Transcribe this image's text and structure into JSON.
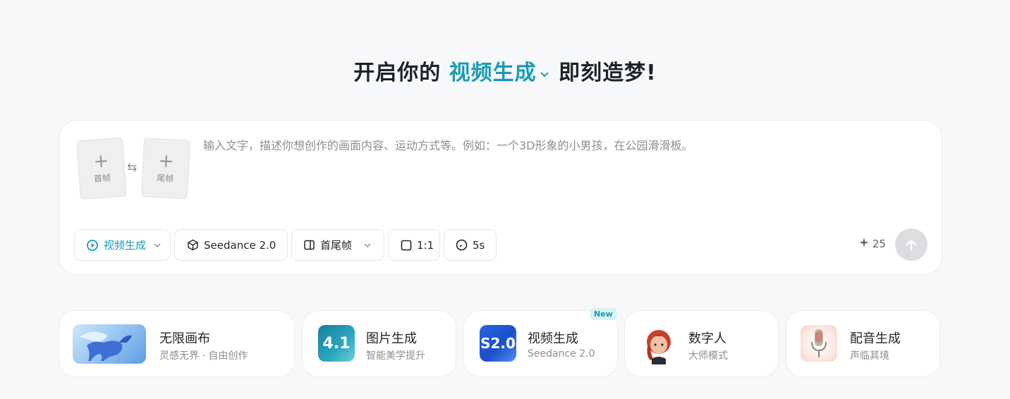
{
  "headline": {
    "prefix": "开启你的",
    "mode": "视频生成",
    "suffix": "即刻造梦!"
  },
  "composer": {
    "first_frame_label": "首帧",
    "last_frame_label": "尾帧",
    "prompt_placeholder": "输入文字，描述你想创作的画面内容、运动方式等。例如：一个3D形象的小男孩，在公园滑滑板。",
    "prompt_value": "",
    "toolbar": {
      "mode": "视频生成",
      "model": "Seedance 2.0",
      "frames_mode": "首尾帧",
      "ratio": "1:1",
      "duration": "5s"
    },
    "credits": "25"
  },
  "features": [
    {
      "title": "无限画布",
      "subtitle": "灵感无界 · 自由创作",
      "icon": "pegasus-image"
    },
    {
      "title": "图片生成",
      "subtitle": "智能美学提升",
      "icon": "image-4-1-thumb",
      "thumb_text": "4.1"
    },
    {
      "title": "视频生成",
      "subtitle": "Seedance 2.0",
      "icon": "video-s2-thumb",
      "thumb_text": "S2.0",
      "badge": "New"
    },
    {
      "title": "数字人",
      "subtitle": "大师模式",
      "icon": "avatar-girl-image"
    },
    {
      "title": "配音生成",
      "subtitle": "声临其境",
      "icon": "microphone-image"
    }
  ],
  "colors": {
    "accent": "#1a9bb5",
    "background": "#f7f8fa",
    "send_disabled": "#dcdde0"
  }
}
